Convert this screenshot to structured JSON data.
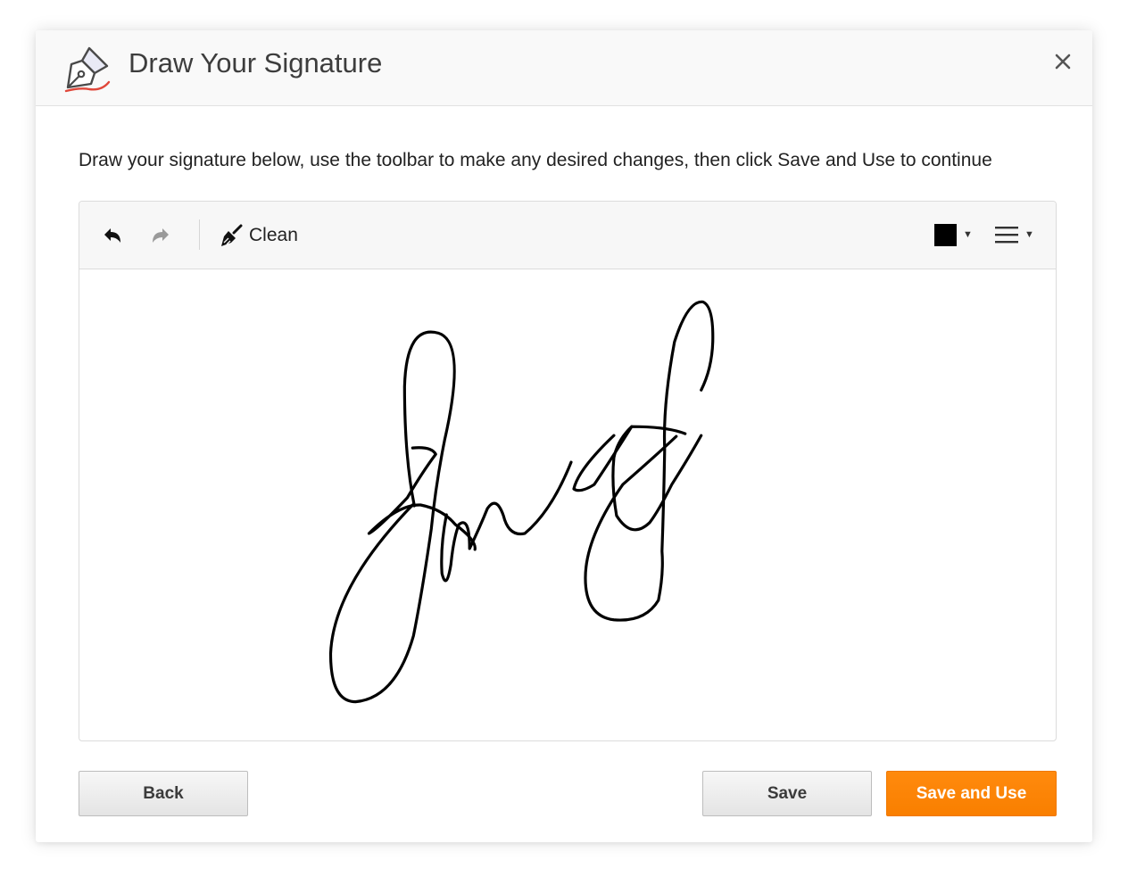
{
  "dialog": {
    "title": "Draw Your Signature",
    "icon": "pen-nib-icon",
    "close_icon": "close-icon",
    "close_symbol": "✕"
  },
  "instructions": "Draw your signature below, use the toolbar to make any desired changes, then click Save and Use to continue",
  "toolbar": {
    "undo_icon": "undo-icon",
    "redo_icon": "redo-icon",
    "clean_label": "Clean",
    "clean_icon": "broom-icon",
    "pen_color": "#000000",
    "color_caret": "▼",
    "width_caret": "▼"
  },
  "buttons": {
    "back": "Back",
    "save": "Save",
    "save_and_use": "Save and Use"
  },
  "colors": {
    "accent": "#ff8000",
    "header_bg": "#f9f9f9",
    "toolbar_bg": "#f7f7f7",
    "icon_red": "#e0473a"
  }
}
